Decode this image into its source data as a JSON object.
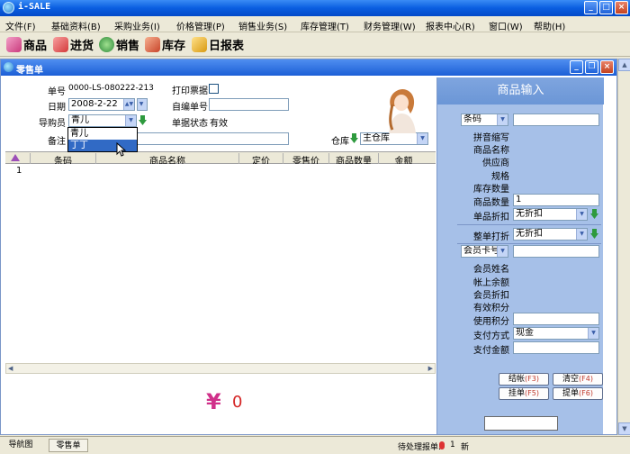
{
  "app": {
    "title": "i-SALE"
  },
  "menu": [
    "文件(F)",
    "基础资料(B)",
    "采购业务(I)",
    "价格管理(P)",
    "销售业务(S)",
    "库存管理(T)",
    "财务管理(W)",
    "报表中心(R)",
    "窗口(W)",
    "帮助(H)"
  ],
  "toolbar": [
    {
      "label": "商品",
      "icon": "goods-icon",
      "color": "#d94a8c"
    },
    {
      "label": "进货",
      "icon": "purchase-icon",
      "color": "#e24f4f"
    },
    {
      "label": "销售",
      "icon": "sales-icon",
      "color": "#3a9a4a"
    },
    {
      "label": "库存",
      "icon": "inventory-icon",
      "color": "#d64a3a"
    },
    {
      "label": "日报表",
      "icon": "daily-report-icon",
      "color": "#e0a020"
    }
  ],
  "child_window": {
    "title": "零售单"
  },
  "form": {
    "order_no_label": "单号",
    "order_no": "0000-LS-080222-213",
    "print_label": "打印票据",
    "date_label": "日期",
    "date": "2008-2-22",
    "custom_no_label": "自编单号",
    "guide_label": "导购员",
    "guide_value": "青儿",
    "guide_options": [
      "青儿",
      "丁丁"
    ],
    "status_label": "单据状态",
    "status_value": "有效",
    "remark_label": "备注",
    "warehouse_label": "仓库",
    "warehouse_value": "主仓库"
  },
  "grid": {
    "columns": [
      "条码",
      "商品名称",
      "定价",
      "零售价",
      "商品数量",
      "金额"
    ],
    "rows": [
      {
        "index": "1"
      }
    ]
  },
  "total": {
    "currency": "¥",
    "amount": "0"
  },
  "right_panel": {
    "title": "商品输入",
    "search_type": "条码",
    "labels": [
      "拼音缩写",
      "商品名称",
      "供应商",
      "规格",
      "库存数量",
      "商品数量",
      "单品折扣"
    ],
    "quantity": "1",
    "item_discount": "无折扣",
    "whole_discount_label": "整单打折",
    "whole_discount": "无折扣",
    "member_type": "会员卡号",
    "member_labels": [
      "会员姓名",
      "帐上余额",
      "会员折扣",
      "有效积分",
      "使用积分",
      "支付方式",
      "支付金额"
    ],
    "payment_method": "现金",
    "buttons": [
      {
        "label": "结帐",
        "key": "(F3)"
      },
      {
        "label": "清空",
        "key": "(F4)"
      },
      {
        "label": "挂单",
        "key": "(F5)"
      },
      {
        "label": "提单",
        "key": "(F6)"
      }
    ]
  },
  "taskbar": {
    "nav_label": "导航图",
    "tab_label": "零售单",
    "pending_label": "待处理报单:",
    "pending_count": "1",
    "tail_text": "新"
  }
}
